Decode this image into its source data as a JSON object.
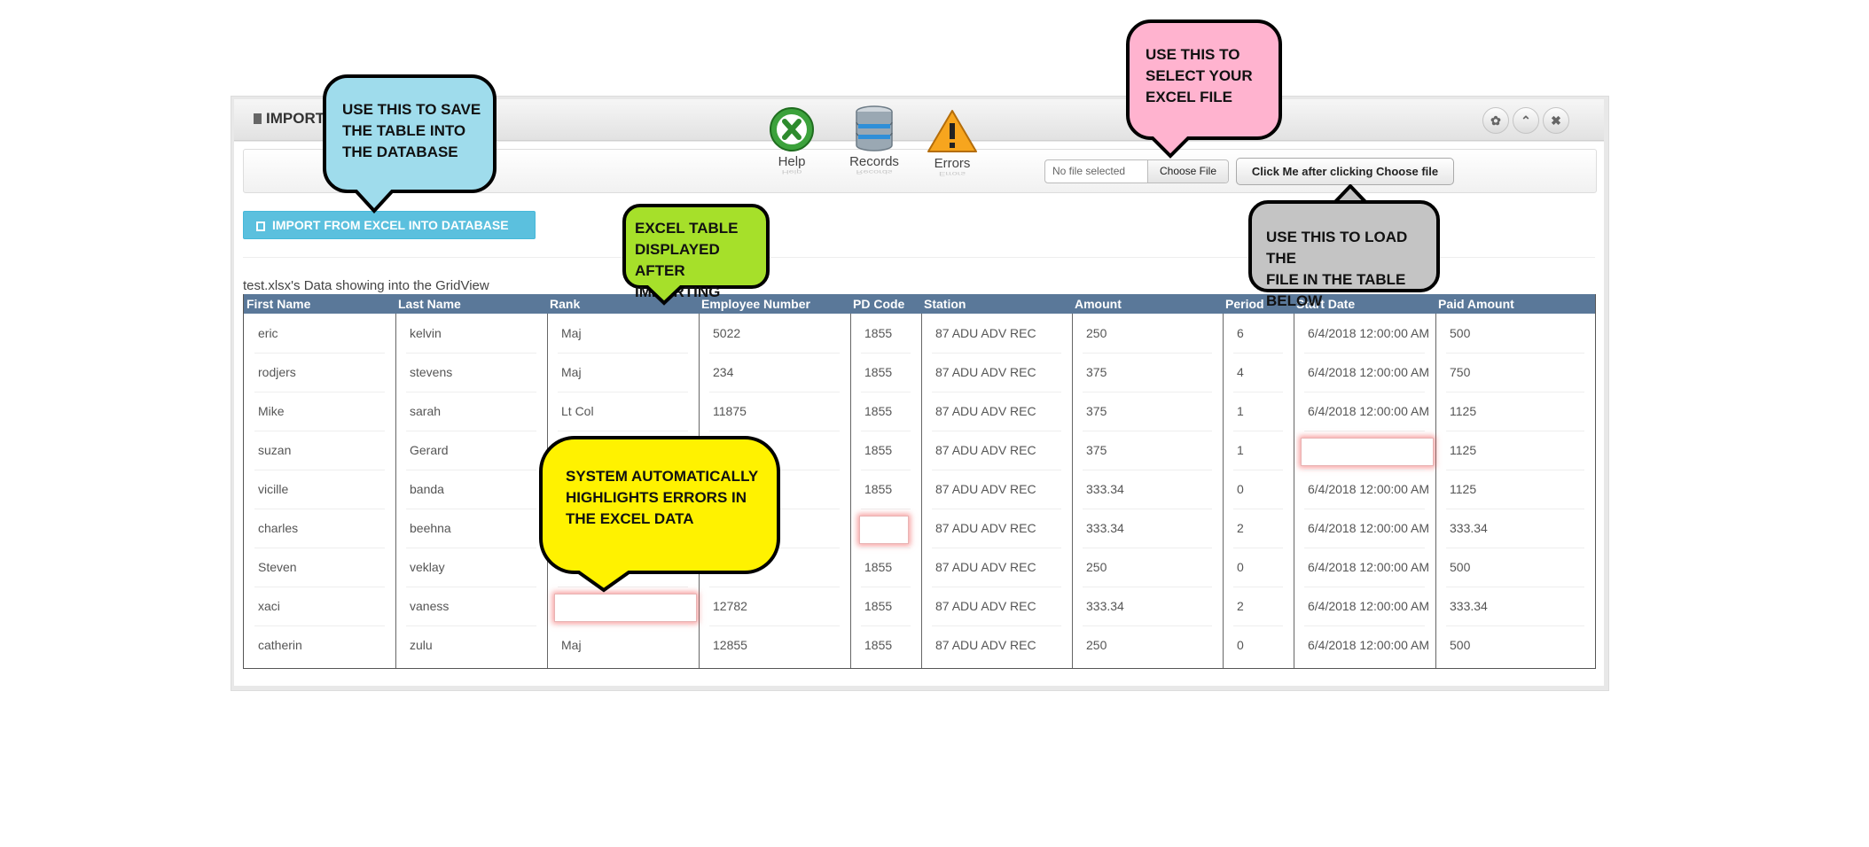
{
  "panel": {
    "title": "IMPORT"
  },
  "header_controls": [
    {
      "icon": "gear-icon",
      "glyph": "✿"
    },
    {
      "icon": "chevron-up-icon",
      "glyph": "⌃"
    },
    {
      "icon": "close-icon",
      "glyph": "✖"
    }
  ],
  "toolbar": {
    "help_label": "Help",
    "records_label": "Records",
    "errors_label": "Errors",
    "file_name": "No file selected",
    "choose_file_label": "Choose File",
    "load_button_label": "Click Me after clicking Choose file"
  },
  "import_button_label": "IMPORT FROM EXCEL INTO DATABASE",
  "grid": {
    "caption": "test.xlsx's Data showing into the GridView",
    "columns": [
      "First Name",
      "Last Name",
      "Rank",
      "Employee Number",
      "PD Code",
      "Station",
      "Amount",
      "Period",
      "Start Date",
      "Paid Amount"
    ],
    "rows": [
      [
        "eric",
        "kelvin",
        "Maj",
        "5022",
        "1855",
        "87 ADU ADV REC",
        "250",
        "6",
        "6/4/2018 12:00:00 AM",
        "500"
      ],
      [
        "rodjers",
        "stevens",
        "Maj",
        "234",
        "1855",
        "87 ADU ADV REC",
        "375",
        "4",
        "6/4/2018 12:00:00 AM",
        "750"
      ],
      [
        "Mike",
        "sarah",
        "Lt Col",
        "11875",
        "1855",
        "87 ADU ADV REC",
        "375",
        "1",
        "6/4/2018 12:00:00 AM",
        "1125"
      ],
      [
        "suzan",
        "Gerard",
        "",
        "",
        "1855",
        "87 ADU ADV REC",
        "375",
        "1",
        "",
        "1125"
      ],
      [
        "vicille",
        "banda",
        "",
        "",
        "1855",
        "87 ADU ADV REC",
        "333.34",
        "0",
        "6/4/2018 12:00:00 AM",
        "1125"
      ],
      [
        "charles",
        "beehna",
        "",
        "",
        "",
        "87 ADU ADV REC",
        "333.34",
        "2",
        "6/4/2018 12:00:00 AM",
        "333.34"
      ],
      [
        "Steven",
        "veklay",
        "",
        "",
        "1855",
        "87 ADU ADV REC",
        "250",
        "0",
        "6/4/2018 12:00:00 AM",
        "500"
      ],
      [
        "xaci",
        "vaness",
        "",
        "12782",
        "1855",
        "87 ADU ADV REC",
        "333.34",
        "2",
        "6/4/2018 12:00:00 AM",
        "333.34"
      ],
      [
        "catherin",
        "zulu",
        "Maj",
        "12855",
        "1855",
        "87 ADU ADV REC",
        "250",
        "0",
        "6/4/2018 12:00:00 AM",
        "500"
      ]
    ],
    "error_cells": [
      [
        3,
        8
      ],
      [
        5,
        4
      ],
      [
        7,
        2
      ]
    ]
  },
  "callouts": {
    "save": "USE THIS TO SAVE\nTHE TABLE INTO\nTHE DATABASE",
    "select": "USE THIS TO\nSELECT YOUR\nEXCEL FILE",
    "table": "EXCEL TABLE\nDISPLAYED AFTER\nIMPORTING",
    "load": "USE THIS TO LOAD THE\nFILE IN THE TABLE\nBELOW",
    "errors": "SYSTEM AUTOMATICALLY\nHIGHLIGHTS ERRORS IN\nTHE EXCEL DATA"
  },
  "colors": {
    "callout_save": "#9fdcec",
    "callout_select": "#ffb3cf",
    "callout_table": "#a6e02a",
    "callout_load": "#c4c4c4",
    "callout_errors": "#fff200",
    "grid_header": "#5a7899",
    "import_button": "#5bc0de"
  }
}
